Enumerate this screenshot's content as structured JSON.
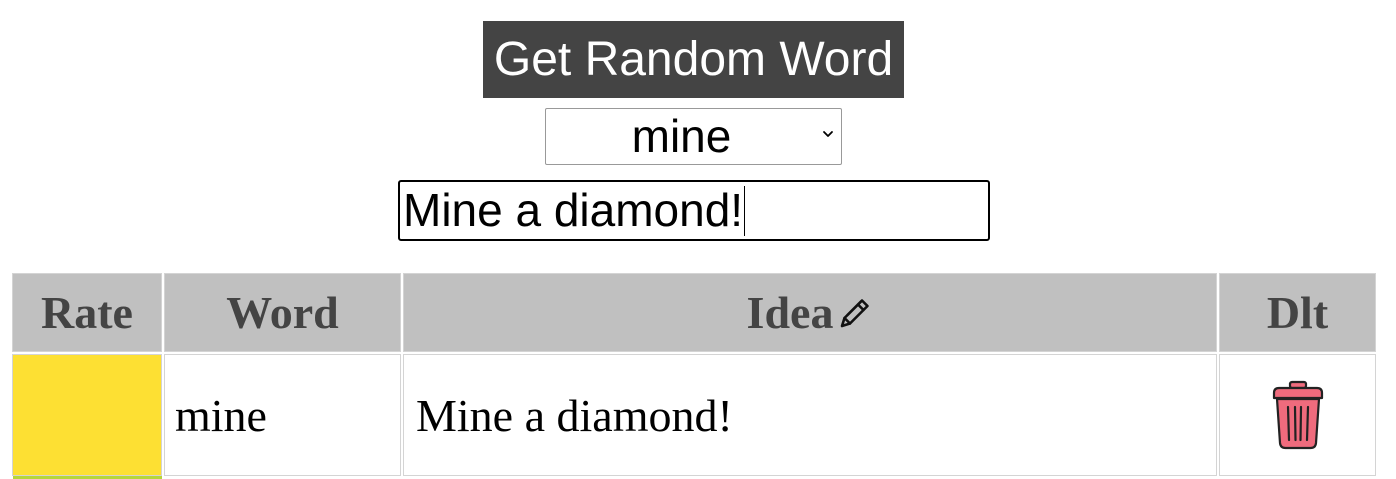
{
  "controls": {
    "get_word_label": "Get Random Word",
    "selected_word": "mine",
    "idea_input_value": "Mine a diamond!"
  },
  "table": {
    "headers": {
      "rate": "Rate",
      "word": "Word",
      "idea": "Idea",
      "delete": "Dlt"
    },
    "header_idea_icon": "pencil-icon",
    "rows": [
      {
        "rate_color": "#fde033",
        "word": "mine",
        "idea": "Mine a diamond!",
        "delete_icon": "trash-icon"
      }
    ],
    "next_row_rate_color": "#b5d63a"
  },
  "colors": {
    "button_bg": "#444444",
    "header_bg": "#c0c0c0",
    "header_text": "#444444",
    "trash_red": "#ef6b7d"
  }
}
